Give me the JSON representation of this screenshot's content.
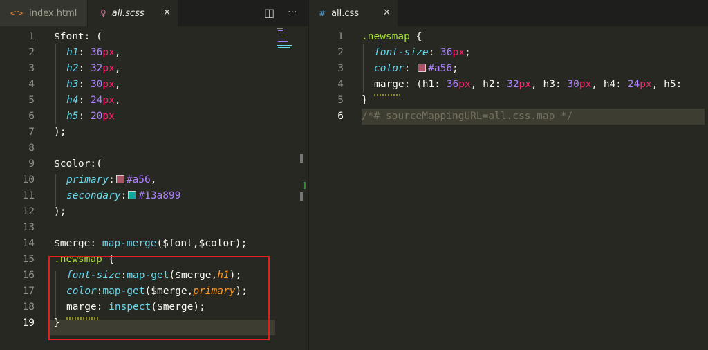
{
  "left_tabs": [
    {
      "label": "index.html",
      "icon": "<>"
    },
    {
      "label": "all.scss",
      "icon": "♀"
    }
  ],
  "split_icon": "◫",
  "more_icon": "···",
  "right_tab": {
    "label": "all.css",
    "icon": "#"
  },
  "close_glyph": "✕",
  "scss": {
    "l1": {
      "a": "$font",
      "b": ": ("
    },
    "l2": {
      "k": "h1",
      "n": "36",
      "u": "px",
      "e": ","
    },
    "l3": {
      "k": "h2",
      "n": "32",
      "u": "px",
      "e": ","
    },
    "l4": {
      "k": "h3",
      "n": "30",
      "u": "px",
      "e": ","
    },
    "l5": {
      "k": "h4",
      "n": "24",
      "u": "px",
      "e": ","
    },
    "l6": {
      "k": "h5",
      "n": "20",
      "u": "px"
    },
    "l7": ");",
    "l9": {
      "a": "$color",
      "b": ":("
    },
    "l10": {
      "k": "primary",
      "hex": "#a56",
      "e": ","
    },
    "l11": {
      "k": "secondary",
      "hex": "#13a899"
    },
    "l13": ");",
    "l14": {
      "a": "$merge",
      "b": ": ",
      "fn": "map-merge",
      "args": "($font,$color);"
    },
    "l15": {
      "sel": ".newsmap",
      "b": " {"
    },
    "l16": {
      "p": "font-size",
      "c": ":",
      "fn": "map-get",
      "a1": "($merge,",
      "arg": "h1",
      "a2": ");"
    },
    "l17": {
      "p": "color",
      "c": ":",
      "fn": "map-get",
      "a1": "($merge,",
      "arg": "primary",
      "a2": ");"
    },
    "l18": {
      "p": "marge",
      "c": ": ",
      "fn": "inspect",
      "a1": "($merge);"
    },
    "l19": "}"
  },
  "css": {
    "l1": {
      "sel": ".newsmap",
      "b": " {"
    },
    "l2": {
      "p": "font-size",
      "c": ": ",
      "n": "36",
      "u": "px",
      "e": ";"
    },
    "l3": {
      "p": "color",
      "c": ": ",
      "hex": "#a56",
      "e": ";"
    },
    "l4": {
      "p": "marge",
      "c": ": (h1: ",
      "n1": "36",
      "u1": "px",
      "m1": ", h2: ",
      "n2": "32",
      "u2": "px",
      "m2": ", h3: ",
      "n3": "30",
      "u3": "px",
      "m3": ", h4: ",
      "n4": "24",
      "u4": "px",
      "m4": ", h5:"
    },
    "l5": "}",
    "l6": "/*# sourceMappingURL=all.css.map */"
  },
  "colors": {
    "primary": "#aa5566",
    "secondary": "#13a899",
    "highlight_box": "#e02020"
  },
  "line_numbers_left": [
    "1",
    "2",
    "3",
    "4",
    "5",
    "6",
    "7",
    "8",
    "9",
    "10",
    "11",
    "12",
    "13",
    "14",
    "15",
    "16",
    "17",
    "18",
    "19"
  ],
  "line_numbers_right": [
    "1",
    "2",
    "3",
    "4",
    "5",
    "6"
  ]
}
